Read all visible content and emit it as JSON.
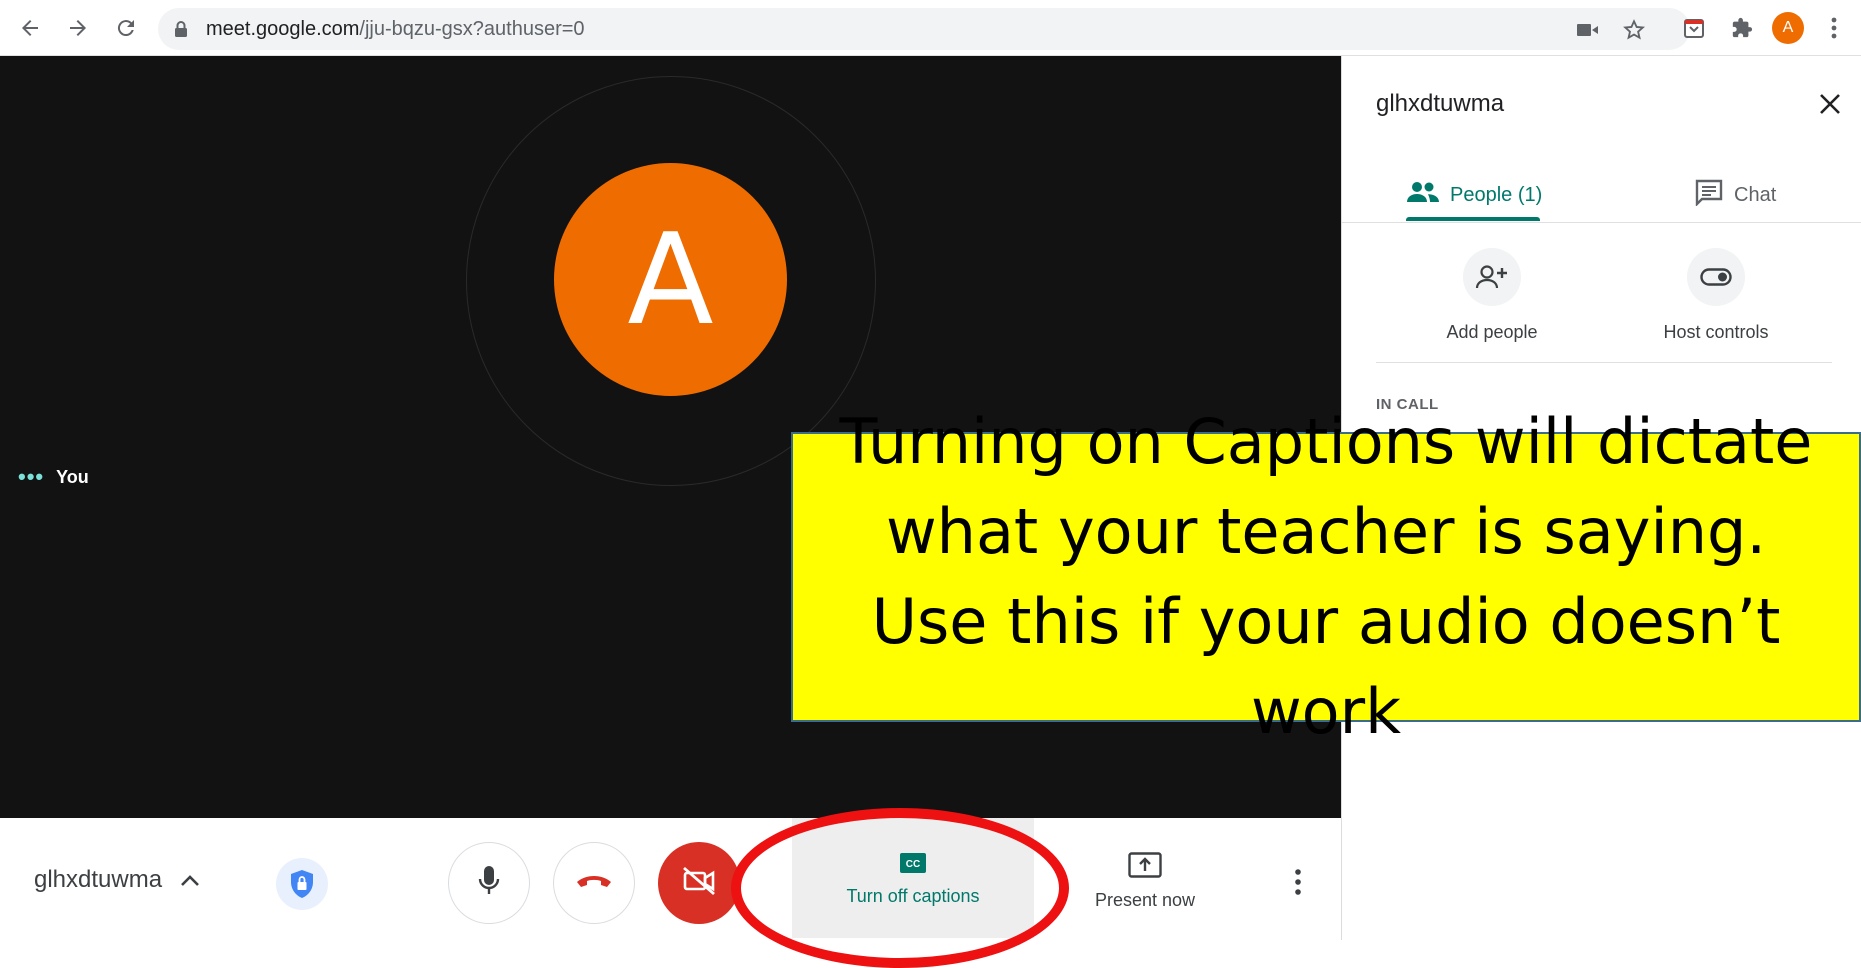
{
  "browser": {
    "url_host": "meet.google.com",
    "url_path": "/jju-bqzu-gsx?authuser=0",
    "profile_initial": "A"
  },
  "stage": {
    "avatar_letter": "A",
    "self_label": "You"
  },
  "panel": {
    "title": "glhxdtuwma",
    "tabs": [
      {
        "label": "People (1)",
        "active": true
      },
      {
        "label": "Chat",
        "active": false
      }
    ],
    "actions": [
      {
        "label": "Add people",
        "icon": "person-add-icon"
      },
      {
        "label": "Host controls",
        "icon": "toggle-icon"
      }
    ],
    "section_label": "IN CALL"
  },
  "bottom_bar": {
    "meeting_code": "glhxdtuwma",
    "captions_label": "Turn off captions",
    "present_label": "Present now"
  },
  "annotation": {
    "text": "Turning on Captions will dictate what your teacher is saying. Use this if your audio doesn’t work"
  },
  "colors": {
    "accent": "#00796b",
    "avatar": "#ef6c00",
    "hangup": "#d93025",
    "callout_bg": "#ffff00",
    "ellipse": "#ee1111"
  }
}
